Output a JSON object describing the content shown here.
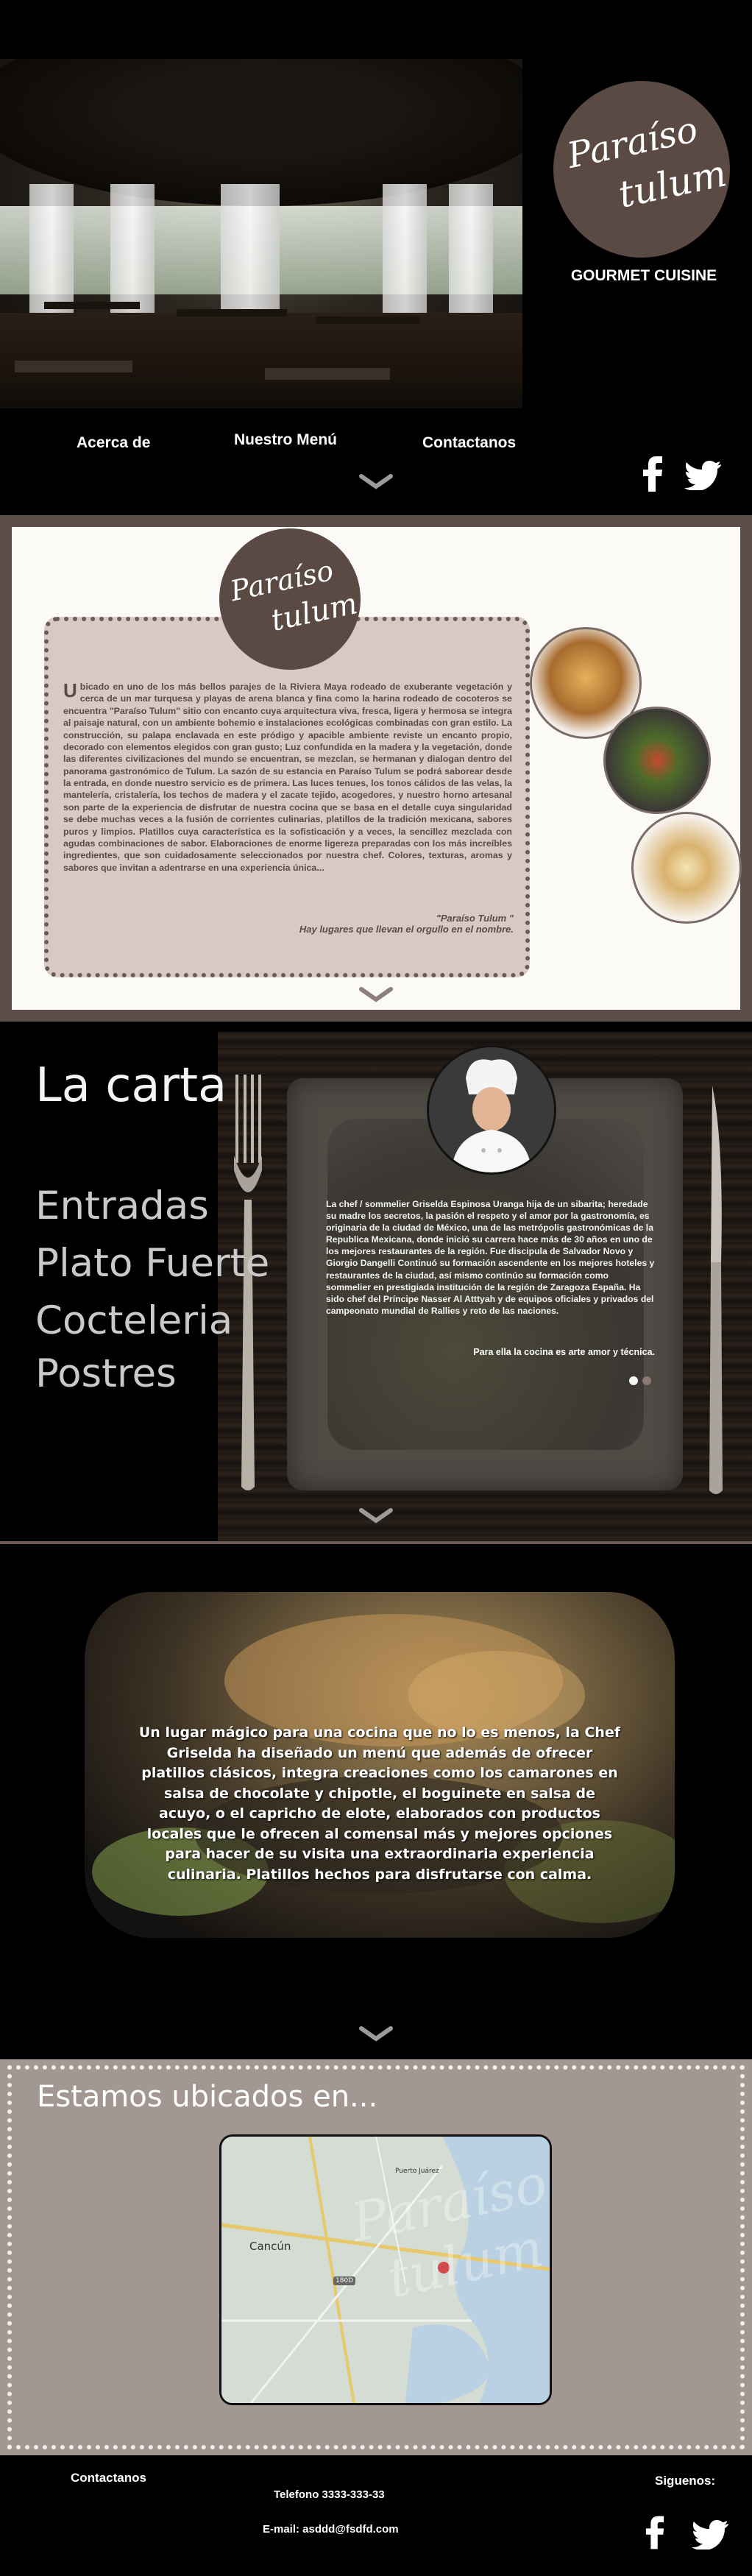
{
  "brand": {
    "logo_line1": "Paraíso",
    "logo_line2": "tulum",
    "tagline": "GOURMET CUISINE"
  },
  "nav": {
    "about": "Acerca de",
    "menu": "Nuestro Menú",
    "contact": "Contactanos"
  },
  "about": {
    "dropcap": "U",
    "body": "bicado en uno de los más bellos parajes de la Riviera Maya rodeado de exuberante vegetación y cerca de un mar turquesa y playas de arena blanca y fina como la harina rodeado de cocoteros se encuentra \"Paraíso Tulum\" sitio con encanto cuya arquitectura viva, fresca, ligera y hermosa se integra al paisaje natural, con un ambiente bohemio e instalaciones ecológicas combinadas con gran estilo. La construcción, su palapa enclavada en este pródigo y apacible ambiente reviste un encanto propio, decorado con elementos elegidos con gran gusto; Luz confundida en la madera y la vegetación, donde las diferentes civilizaciones del mundo se encuentran, se mezclan, se hermanan y dialogan dentro del panorama gastronómico de Tulum. La sazón de su estancia en Paraíso Tulum se podrá saborear desde la entrada, en donde nuestro servicio es de primera. Las luces tenues, los tonos cálidos de las velas, la mantelería, cristalería, los techos de madera y el zacate tejido, acogedores, y nuestro horno artesanal son parte de la experiencia de disfrutar de nuestra cocina que se basa en el detalle cuya singularidad se debe muchas veces a la fusión de corrientes culinarias, platillos de la tradición mexicana, sabores puros y limpios. Platillos cuya característica es la sofisticación y a veces, la sencillez mezclada con agudas combinaciones de sabor. Elaboraciones de enorme ligereza preparadas con los más increíbles ingredientes, que son cuidadosamente seleccionados por nuestra chef. Colores, texturas, aromas y sabores que invitan a adentrarse en una experiencia única...",
    "quote_line1": "\"Paraíso Tulum \"",
    "quote_line2": "Hay lugares que llevan el orgullo en el nombre."
  },
  "carta": {
    "title": "La carta",
    "items": [
      "Entradas",
      "Plato Fuerte",
      "Cocteleria",
      "Postres"
    ],
    "chef_bio": "La chef / sommelier  Griselda Espinosa Uranga hija de un sibarita; heredade su madre los secretos, la pasión el respeto y el amor por la gastronomía, es originaria de la ciudad de México, una de las metrópolis gastronómicas de la Republica Mexicana, donde inició su carrera hace más de 30 años en uno de los mejores restaurantes de la región. Fue discipula de Salvador Novo y Giorgio Dangelli Continuó su formación ascendente en los mejores hoteles y restaurantes de la ciudad, así mismo continúo su formación como sommelier en prestigiada institución de la región de Zaragoza España. Ha sido chef del Príncipe Nasser Al Atttyah y de equipos oficiales y privados del campeonato mundial de Rallies y reto de las naciones.",
    "chef_motto": "Para ella la cocina es arte amor y técnica."
  },
  "promo": {
    "text": "Un lugar mágico para una cocina que no lo es menos, la Chef Griselda ha diseñado un menú que además de ofrecer platillos clásicos, integra creaciones como los camarones en salsa de chocolate y chipotle,  el boguinete en salsa de acuyo, o el capricho de elote, elaborados  con productos locales que le ofrecen al comensal más y mejores opciones para hacer de su visita una extraordinaria experiencia culinaria. Platillos hechos para disfrutarse con calma."
  },
  "location": {
    "title": "Estamos ubicados en...",
    "map_city": "Cancún",
    "map_town": "Puerto Juárez",
    "map_road": "180D"
  },
  "footer": {
    "contact_title": "Contactanos",
    "phone": "Telefono 3333-333-33",
    "email": "E-mail: asddd@fsdfd.com",
    "follow": "Siguenos:"
  },
  "icons": {
    "facebook": "facebook-icon",
    "twitter": "twitter-icon",
    "chevron": "chevron-down-icon"
  },
  "colors": {
    "brand_brown": "#5a4a43",
    "card_beige": "#d8c9c2",
    "location_bg": "#a39792"
  }
}
